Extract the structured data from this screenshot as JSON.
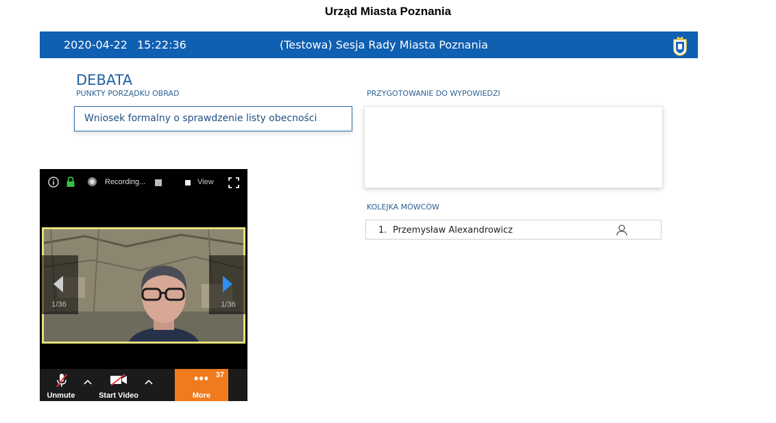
{
  "page": {
    "title": "Urząd Miasta Poznania"
  },
  "session_bar": {
    "date": "2020-04-22",
    "time": "15:22:36",
    "session_name": "(Testowa) Sesja Rady Miasta Poznania"
  },
  "debate": {
    "title": "DEBATA",
    "agenda_label": "PUNKTY PORZĄDKU OBRAD",
    "agenda_item": "Wniosek formalny o sprawdzenie listy obecności",
    "prep_label": "PRZYGOTOWANIE DO WYPOWIEDZI",
    "queue_label": "KOLEJKA MÓWCÓW",
    "speakers": [
      {
        "number": "1.",
        "name": "Przemysław Alexandrowicz"
      }
    ]
  },
  "zoom": {
    "recording_label": "Recording...",
    "view_label": "View",
    "left_counter": "1/36",
    "right_counter": "1/36",
    "unmute_label": "Unmute",
    "start_video_label": "Start Video",
    "more_label": "More",
    "more_badge": "37"
  },
  "colors": {
    "session_bar": "#0f5fb2",
    "heading_blue": "#1f5f9e",
    "more_orange": "#f07b1e",
    "video_border": "#e6e07a"
  }
}
